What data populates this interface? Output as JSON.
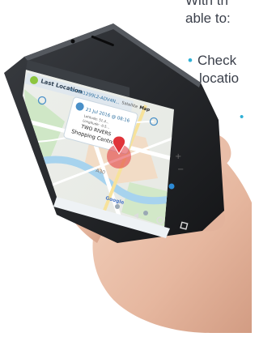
{
  "intro_line1": "With th",
  "intro_line2": "able to:",
  "bullet1_line1": "Check",
  "bullet1_line2": "locatio",
  "bullet2_dot": "•",
  "app": {
    "title": "Last Location",
    "subtitle": "for FH1299L2-ADV4N...",
    "tab_satellite": "Satellite",
    "tab_map": "Map"
  },
  "popup": {
    "datetime": "21 Jul 2016 @ 08:16",
    "line1": "Latitude: 51.4...",
    "line2": "Longitude: -0.5...",
    "line3": "TWO RIVERS",
    "line4": "Shopping Centre"
  },
  "map_labels": {
    "area": "A30",
    "brand": "Google"
  },
  "colors": {
    "accent": "#2fb0d6",
    "marker": "#e0343a",
    "header": "#dfe7ee",
    "phone_body": "#1d1f22"
  }
}
